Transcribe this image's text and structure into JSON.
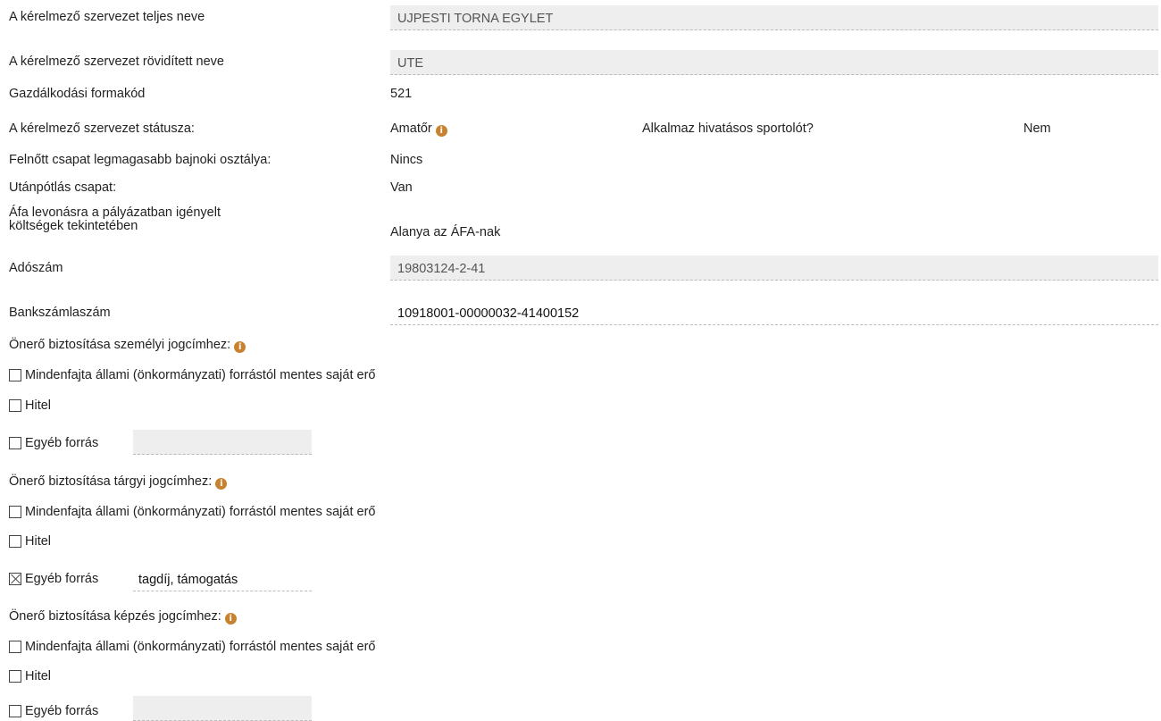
{
  "form": {
    "full_name_label": "A kérelmező szervezet teljes neve",
    "full_name_value": "UJPESTI TORNA EGYLET",
    "short_name_label": "A kérelmező szervezet rövidített neve",
    "short_name_value": "UTE",
    "econ_code_label": "Gazdálkodási formakód",
    "econ_code_value": "521",
    "status_label": "A kérelmező szervezet státusza:",
    "status_value": "Amatőr",
    "pro_label": "Alkalmaz hivatásos sportolót?",
    "pro_value": "Nem",
    "adult_team_label": "Felnőtt csapat legmagasabb bajnoki osztálya:",
    "adult_team_value": "Nincs",
    "youth_team_label": "Utánpótlás csapat:",
    "youth_team_value": "Van",
    "vat_label_line1": "Áfa levonásra a pályázatban igényelt",
    "vat_label_line2": "költségek tekintetében",
    "vat_value": "Alanya az ÁFA-nak",
    "tax_label": "Adószám",
    "tax_value": "19803124-2-41",
    "bank_label": "Bankszámlaszám",
    "bank_value": "10918001-00000032-41400152"
  },
  "info_glyph": "i",
  "sections": [
    {
      "title": "Önerő biztosítása személyi jogcímhez:",
      "opt_state": "Mindenfajta állami (önkormányzati) forrástól mentes saját erő",
      "opt_loan": "Hitel",
      "opt_other": "Egyéb forrás",
      "other_value": "",
      "checked": [
        false,
        false,
        false
      ]
    },
    {
      "title": "Önerő biztosítása tárgyi jogcímhez:",
      "opt_state": "Mindenfajta állami (önkormányzati) forrástól mentes saját erő",
      "opt_loan": "Hitel",
      "opt_other": "Egyéb forrás",
      "other_value": "tagdíj, támogatás",
      "checked": [
        false,
        false,
        true
      ]
    },
    {
      "title": "Önerő biztosítása képzés jogcímhez:",
      "opt_state": "Mindenfajta állami (önkormányzati) forrástól mentes saját erő",
      "opt_loan": "Hitel",
      "opt_other": "Egyéb forrás",
      "other_value": "",
      "checked": [
        false,
        false,
        false
      ]
    }
  ],
  "colors": {
    "info_icon": "#c8822f",
    "field_bg": "#eeeeee"
  }
}
